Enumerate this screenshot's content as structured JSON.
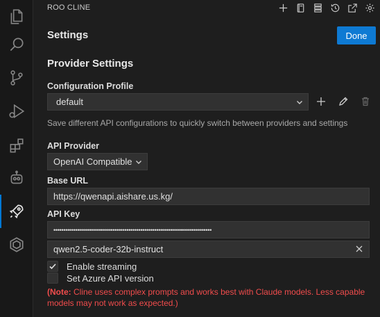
{
  "header": {
    "title": "ROO CLINE"
  },
  "header_icons": [
    "plus-icon",
    "notebook-icon",
    "server-icon",
    "history-icon",
    "popout-icon",
    "gear-icon"
  ],
  "activity_bar": [
    "explorer-icon",
    "search-icon",
    "source-control-icon",
    "run-debug-icon",
    "extensions-icon",
    "robot-icon",
    "rocket-icon",
    "hexagon-icon"
  ],
  "settings": {
    "title": "Settings",
    "done_label": "Done"
  },
  "provider": {
    "section_title": "Provider Settings",
    "config_profile": {
      "label": "Configuration Profile",
      "value": "default",
      "hint": "Save different API configurations to quickly switch between providers and settings"
    },
    "api_provider": {
      "label": "API Provider",
      "value": "OpenAI Compatible"
    },
    "base_url": {
      "label": "Base URL",
      "value": "https://qwenapi.aishare.us.kg/"
    },
    "api_key": {
      "label": "API Key",
      "value": "••••••••••••••••••••••••••••••••••••••••••••••••••••••••••••••••••••••••••••••••"
    },
    "model": {
      "value": "qwen2.5-coder-32b-instruct"
    },
    "enable_streaming": {
      "label": "Enable streaming",
      "checked": true
    },
    "azure_api_version": {
      "label": "Set Azure API version",
      "checked": false
    },
    "note": {
      "prefix": "(Note:",
      "text": " Cline uses complex prompts and works best with Claude models. Less capable models may not work as expected.)"
    }
  },
  "colors": {
    "accent": "#0e7ad3",
    "warning": "#f14c4c",
    "background": "#1e1e1e"
  }
}
